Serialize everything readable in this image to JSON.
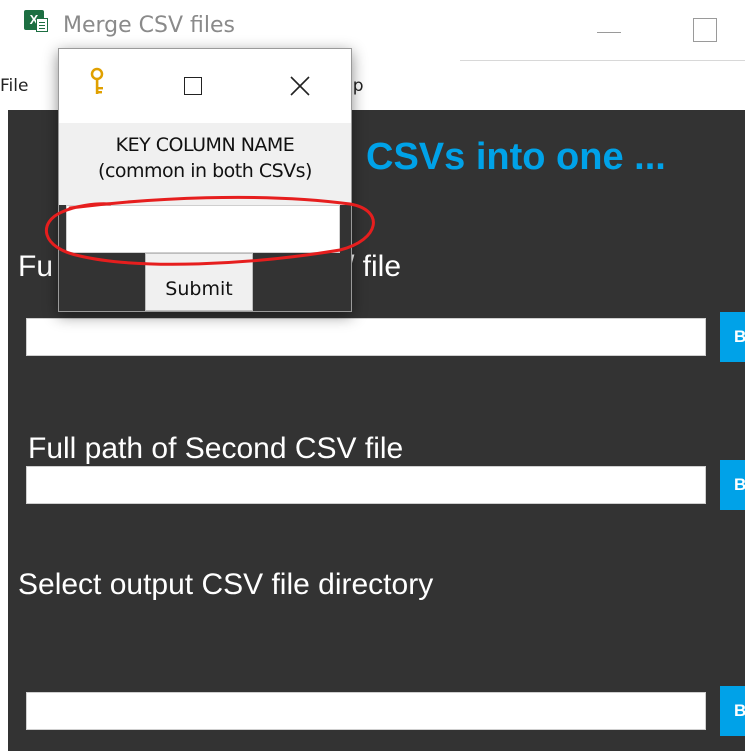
{
  "window": {
    "title": "Merge CSV files",
    "app_icon": "excel-icon",
    "controls": [
      "minimize-icon",
      "maximize-icon"
    ]
  },
  "menubar": {
    "items": [
      "File",
      "lp"
    ]
  },
  "main": {
    "heading_visible": "CSVs into one ...",
    "fields": [
      {
        "label": "Fu",
        "label_tail": "/ file",
        "value": "",
        "button": "B"
      },
      {
        "label": "Full path of Second CSV file",
        "value": "",
        "button": "B"
      },
      {
        "label": "Select output CSV file directory",
        "value": "",
        "button": "B"
      }
    ]
  },
  "dialog": {
    "icon": "key-icon",
    "controls": [
      "maximize-icon",
      "close-icon"
    ],
    "prompt_line1": "KEY COLUMN NAME",
    "prompt_line2": "(common in both CSVs)",
    "input_value": "",
    "submit_label": "Submit"
  },
  "annotation": {
    "type": "red-hand-drawn-circle",
    "color": "#e61e1e"
  },
  "colors": {
    "accent": "#00a2e8",
    "background": "#333333",
    "annotation": "#e61e1e"
  }
}
